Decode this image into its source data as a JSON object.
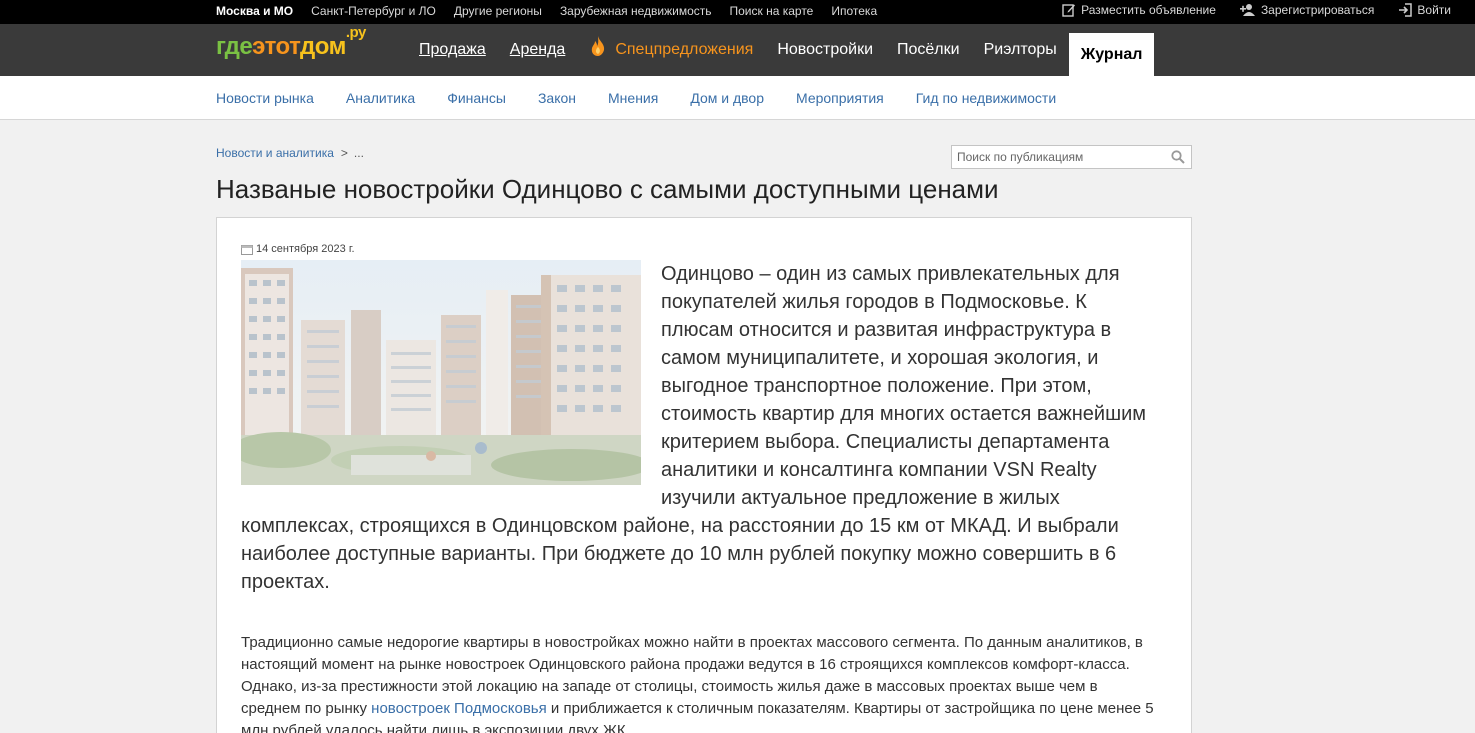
{
  "topbar": {
    "regions": [
      {
        "label": "Москва и МО",
        "active": true
      },
      {
        "label": "Санкт-Петербург и ЛО"
      },
      {
        "label": "Другие регионы"
      },
      {
        "label": "Зарубежная недвижимость"
      },
      {
        "label": "Поиск на карте"
      },
      {
        "label": "Ипотека"
      }
    ],
    "post_ad": "Разместить объявление",
    "register": "Зарегистрироваться",
    "login": "Войти"
  },
  "logo": {
    "part1": "где",
    "part2": "этот",
    "part3": "дом",
    "tld": ".ру"
  },
  "nav": {
    "items": [
      "Продажа",
      "Аренда",
      "Спецпредложения",
      "Новостройки",
      "Посёлки",
      "Риэлторы",
      "Журнал"
    ]
  },
  "subnav": {
    "items": [
      "Новости рынка",
      "Аналитика",
      "Финансы",
      "Закон",
      "Мнения",
      "Дом и двор",
      "Мероприятия",
      "Гид по недвижимости"
    ]
  },
  "breadcrumb": {
    "first": "Новости и аналитика",
    "separator": ">",
    "rest": "..."
  },
  "search": {
    "placeholder": "Поиск по публикациям",
    "value": ""
  },
  "article": {
    "title": "Названые новостройки Одинцово с самыми доступными ценами",
    "date": "14 сентября 2023 г.",
    "lead": "Одинцово – один из самых привлекательных для покупателей жилья городов в Подмосковье. К плюсам относится и развитая инфраструктура в самом муниципалитете, и хорошая экология, и выгодное транспортное положение. При этом, стоимость квартир для многих остается важнейшим критерием выбора. Специалисты департамента аналитики и консалтинга компании VSN Realty изучили актуальное предложение в жилых комплексах, строящихся в Одинцовском районе, на расстоянии до 15 км от МКАД. И выбрали наиболее доступные варианты. При бюджете до 10 млн рублей покупку можно совершить в 6 проектах.",
    "body_before_link": "Традиционно самые недорогие квартиры в новостройках можно найти в проектах массового сегмента. По данным аналитиков, в настоящий момент на рынке новостроек Одинцовского района продажи ведутся в 16 строящихся комплексов комфорт-класса. Однако, из-за престижности этой локацию на западе от столицы, стоимость жилья даже в массовых проектах выше чем в среднем по рынку ",
    "body_link": "новостроек Подмосковья",
    "body_after_link": " и приближается к столичным показателям. Квартиры от застройщика по цене менее 5 млн рублей удалось найти лишь в экспозиции двух ЖК."
  },
  "colors": {
    "topbar": "#000000",
    "nav": "#3a3a3a",
    "link": "#3a6fa8",
    "special": "#f7941d",
    "logo_green": "#7ac143"
  }
}
